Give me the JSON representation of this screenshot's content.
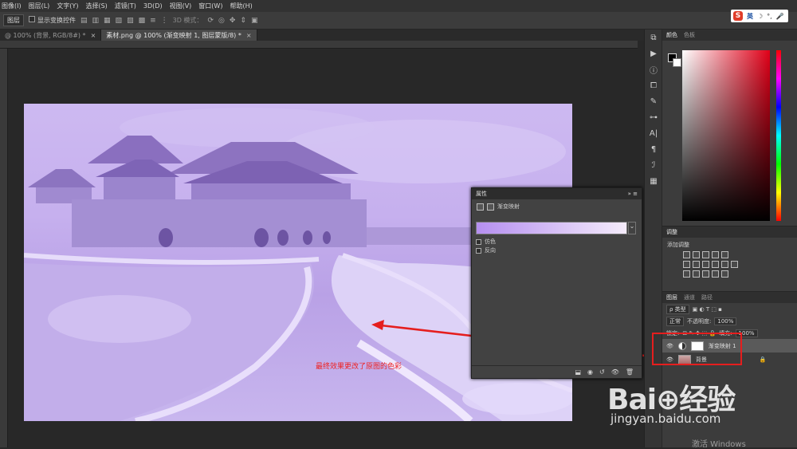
{
  "menubar": {
    "items": [
      "图像(I)",
      "图层(L)",
      "文字(Y)",
      "选择(S)",
      "滤镜(T)",
      "3D(D)",
      "视图(V)",
      "窗口(W)",
      "帮助(H)"
    ]
  },
  "options": {
    "layer_select": "图层",
    "show_transform": "显示变换控件",
    "mode_3d": "3D 模式："
  },
  "ime": {
    "lang": "英"
  },
  "tabs": [
    {
      "label": "@ 100% (背景, RGB/8#) *",
      "close": "×"
    },
    {
      "label": "素材.png @ 100% (渐变映射 1, 图层蒙版/8) *",
      "close": "×"
    }
  ],
  "color_panel": {
    "tab_color": "颜色",
    "tab_swatches": "色板"
  },
  "adjust_panel": {
    "tab": "调整",
    "title": "添加调整"
  },
  "layers_panel": {
    "tabs": [
      "图层",
      "通道",
      "路径"
    ],
    "filter": "ρ 类型",
    "blend_mode": "正常",
    "opacity_label": "不透明度:",
    "opacity_value": "100%",
    "lock_label": "锁定:",
    "fill_label": "填充:",
    "fill_value": "100%",
    "layers": [
      {
        "name": "渐变映射 1",
        "selected": true
      },
      {
        "name": "背景",
        "selected": false
      }
    ]
  },
  "properties": {
    "title": "属性",
    "subtitle": "渐变映射",
    "dither_label": "仿色",
    "reverse_label": "反向"
  },
  "annotation": {
    "text": "最终效果更改了原图的色彩",
    "color": "#ee2222"
  },
  "watermark": {
    "logo": "Bai⊕经验",
    "url": "jingyan.baidu.com"
  },
  "activate": "激活 Windows"
}
